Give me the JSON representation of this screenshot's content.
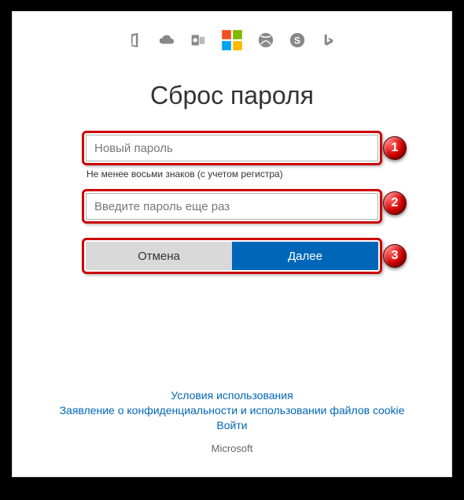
{
  "icons": [
    "office-icon",
    "onedrive-icon",
    "outlook-icon",
    "microsoft-icon",
    "xbox-icon",
    "skype-icon",
    "bing-icon"
  ],
  "title": "Сброс пароля",
  "form": {
    "new_password_placeholder": "Новый пароль",
    "hint": "Не менее восьми знаков (с учетом регистра)",
    "confirm_password_placeholder": "Введите пароль еще раз",
    "cancel_label": "Отмена",
    "next_label": "Далее"
  },
  "markers": {
    "m1": "1",
    "m2": "2",
    "m3": "3"
  },
  "footer": {
    "terms": "Условия использования",
    "privacy": "Заявление о конфиденциальности и использовании файлов cookie",
    "signin": "Войти",
    "brand": "Microsoft"
  },
  "colors": {
    "accent": "#0067b8",
    "highlight": "#cc0000"
  }
}
